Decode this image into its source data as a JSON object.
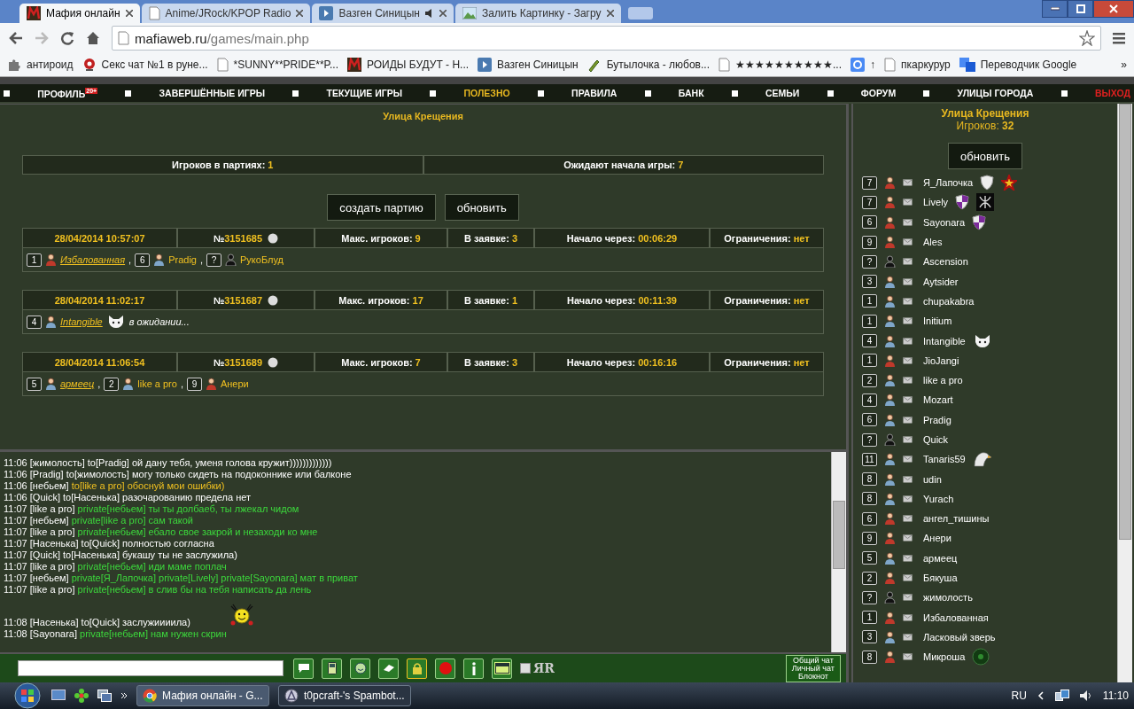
{
  "browser": {
    "tabs": [
      {
        "title": "Мафия онлайн",
        "kind": "mafia",
        "selected": true,
        "audio": false
      },
      {
        "title": "Anime/JRock/KPOP Radio",
        "kind": "page",
        "selected": false,
        "audio": false
      },
      {
        "title": "Вазген Синицын",
        "kind": "play",
        "selected": false,
        "audio": true
      },
      {
        "title": "Залить Картинку - Загру",
        "kind": "image",
        "selected": false,
        "audio": false
      }
    ],
    "address_host": "mafiaweb.ru",
    "address_path": "/games/main.php",
    "bookmarks": [
      {
        "label": "антироид",
        "kind": "puzzle"
      },
      {
        "label": "Секс чат №1 в руне...",
        "kind": "webcam"
      },
      {
        "label": "*SUNNY**PRIDE**P...",
        "kind": "page"
      },
      {
        "label": "РОИДЫ БУДУТ - Н...",
        "kind": "mafia"
      },
      {
        "label": "Вазген Синицын",
        "kind": "play"
      },
      {
        "label": "Бутылочка - любов...",
        "kind": "bottle"
      },
      {
        "label": "★★★★★★★★★★...",
        "kind": "page"
      },
      {
        "label": "↑",
        "kind": "google"
      },
      {
        "label": "пкаркурур",
        "kind": "page"
      },
      {
        "label": "Переводчик Google",
        "kind": "translate"
      }
    ],
    "bookmarks_more": "»"
  },
  "nav": [
    {
      "label": "ПРОФИЛЬ",
      "badge": "20+",
      "kind": "normal",
      "selected": false
    },
    {
      "label": "ЗАВЕРШЁННЫЕ ИГРЫ",
      "kind": "normal",
      "selected": false
    },
    {
      "label": "ТЕКУЩИЕ ИГРЫ",
      "kind": "normal",
      "selected": false
    },
    {
      "label": "ПОЛЕЗНО",
      "kind": "normal",
      "selected": true
    },
    {
      "label": "ПРАВИЛА",
      "kind": "normal",
      "selected": false
    },
    {
      "label": "БАНК",
      "kind": "normal",
      "selected": false
    },
    {
      "label": "СЕМЬИ",
      "kind": "normal",
      "selected": false
    },
    {
      "label": "ФОРУМ",
      "kind": "normal",
      "selected": false
    },
    {
      "label": "УЛИЦЫ ГОРОДА",
      "kind": "normal",
      "selected": false
    },
    {
      "label": "ВЫХОД",
      "kind": "exit",
      "selected": false
    }
  ],
  "lobby": {
    "title": "Улица Крещения",
    "stats": [
      {
        "label": "Игроков в партиях:",
        "value": "1"
      },
      {
        "label": "Ожидают начала игры:",
        "value": "7"
      }
    ],
    "buttons": [
      "создать партию",
      "обновить"
    ],
    "games": [
      {
        "date": "28/04/2014 10:57:07",
        "number_prefix": "№",
        "number": "3151685",
        "info": [
          {
            "label": "Макс. игроков:",
            "value": "9"
          },
          {
            "label": "В заявке:",
            "value": "3"
          },
          {
            "label": "Начало через:",
            "value": "00:06:29"
          },
          {
            "label": "Ограничения:",
            "value": "нет"
          }
        ],
        "players": [
          {
            "rank": "1",
            "kind": "female",
            "name": "Избалованная",
            "link": true,
            "sep": ","
          },
          {
            "rank": "6",
            "kind": "male",
            "name": "Pradig",
            "link": false,
            "sep": ","
          },
          {
            "rank": "?",
            "kind": "unknown",
            "name": "РукоБлуд",
            "link": false
          }
        ]
      },
      {
        "date": "28/04/2014 11:02:17",
        "number_prefix": "№",
        "number": "3151687",
        "info": [
          {
            "label": "Макс. игроков:",
            "value": "17"
          },
          {
            "label": "В заявке:",
            "value": "1"
          },
          {
            "label": "Начало через:",
            "value": "00:11:39"
          },
          {
            "label": "Ограничения:",
            "value": "нет"
          }
        ],
        "players": [
          {
            "rank": "4",
            "kind": "male",
            "name": "Intangible",
            "link": true,
            "badges": [
              {
                "kind": "cat"
              }
            ]
          }
        ],
        "status": "в ожидании..."
      },
      {
        "date": "28/04/2014 11:06:54",
        "number_prefix": "№",
        "number": "3151689",
        "info": [
          {
            "label": "Макс. игроков:",
            "value": "7"
          },
          {
            "label": "В заявке:",
            "value": "3"
          },
          {
            "label": "Начало через:",
            "value": "00:16:16"
          },
          {
            "label": "Ограничения:",
            "value": "нет"
          }
        ],
        "players": [
          {
            "rank": "5",
            "kind": "male",
            "name": "армеец",
            "link": true,
            "sep": ","
          },
          {
            "rank": "2",
            "kind": "male",
            "name": "like a pro",
            "link": false,
            "sep": ","
          },
          {
            "rank": "9",
            "kind": "female",
            "name": "Анери",
            "link": false
          }
        ]
      }
    ]
  },
  "chat": {
    "messages": [
      {
        "time": "11:06",
        "sender": "[жимолость]",
        "text": "to[Pradig] ой дану тебя, уменя голова кружит)))))))))))))",
        "kind": "plain"
      },
      {
        "time": "11:06",
        "sender": "[Pradig]",
        "text": "to[жимолость] могу только сидеть на подоконнике или балконе",
        "kind": "plain"
      },
      {
        "time": "11:06",
        "sender": "[небьем]",
        "text": "to[like a pro] обоснуй мои ошибки)",
        "kind": "to-me"
      },
      {
        "time": "11:06",
        "sender": "[Quick]",
        "text": "to[Насенька] разочарованию предела нет",
        "kind": "plain"
      },
      {
        "time": "11:07",
        "sender": "[like a pro]",
        "text": "private[небьем] ты ты долбаеб, ты лжекал чидом",
        "kind": "private"
      },
      {
        "time": "11:07",
        "sender": "[небьем]",
        "text": "private[like a pro] сам такой",
        "kind": "private"
      },
      {
        "time": "11:07",
        "sender": "[like a pro]",
        "text": "private[небьем] ебало свое закрой и незаходи ко мне",
        "kind": "private"
      },
      {
        "time": "11:07",
        "sender": "[Насенька]",
        "text": "to[Quick] полностью согласна",
        "kind": "plain"
      },
      {
        "time": "11:07",
        "sender": "[Quick]",
        "text": "to[Насенька] букашу ты не заслужила)",
        "kind": "plain"
      },
      {
        "time": "11:07",
        "sender": "[like a pro]",
        "text": "private[небьем] иди маме поплач",
        "kind": "private"
      },
      {
        "time": "11:07",
        "sender": "[небьем]",
        "text": "private[Я_Лапочка] private[Lively] private[Sayonara] мат в приват",
        "kind": "private"
      },
      {
        "time": "11:07",
        "sender": "[like a pro]",
        "text": "private[небьем] в слив бы на тебя написать да лень",
        "kind": "private"
      },
      {
        "time": "11:08",
        "sender": "[Насенька]",
        "text": "to[Quick] заслужиииила)",
        "kind": "plain",
        "smiley": true
      },
      {
        "time": "11:08",
        "sender": "[Sayonara]",
        "text": "private[небьем] нам нужен скрин",
        "kind": "private"
      }
    ],
    "tools": [
      {
        "kind": "speech",
        "selected": false
      },
      {
        "kind": "phone",
        "selected": false
      },
      {
        "kind": "smiley",
        "selected": false
      },
      {
        "kind": "eraser",
        "selected": false
      },
      {
        "kind": "lock",
        "selected": true
      },
      {
        "kind": "record",
        "selected": false
      },
      {
        "kind": "info",
        "selected": false
      },
      {
        "kind": "log",
        "selected": false
      }
    ],
    "translit": {
      "label": "ЯR",
      "checked": false
    },
    "channels": [
      "Общий чат",
      "Личный чат",
      "Блокнот"
    ]
  },
  "street": {
    "title": "Улица Крещения",
    "count_label": "Игроков:",
    "count": "32",
    "button": "обновить",
    "players": [
      {
        "rank": "7",
        "kind": "female",
        "name": "Я_Лапочка",
        "badges": [
          {
            "kind": "shield-white"
          },
          {
            "kind": "star"
          }
        ]
      },
      {
        "rank": "7",
        "kind": "female",
        "name": "Lively",
        "badges": [
          {
            "kind": "shield-purple"
          },
          {
            "kind": "knot"
          }
        ]
      },
      {
        "rank": "6",
        "kind": "female",
        "name": "Sayonara",
        "badges": [
          {
            "kind": "shield-purple"
          }
        ]
      },
      {
        "rank": "9",
        "kind": "female",
        "name": "Ales"
      },
      {
        "rank": "?",
        "kind": "unknown",
        "name": "Ascension"
      },
      {
        "rank": "3",
        "kind": "male",
        "name": "Aytsider"
      },
      {
        "rank": "1",
        "kind": "male",
        "name": "chupakabra"
      },
      {
        "rank": "1",
        "kind": "male",
        "name": "Initium"
      },
      {
        "rank": "4",
        "kind": "male",
        "name": "Intangible",
        "badges": [
          {
            "kind": "cat"
          }
        ]
      },
      {
        "rank": "1",
        "kind": "female",
        "name": "JioJangi"
      },
      {
        "rank": "2",
        "kind": "male",
        "name": "like a pro"
      },
      {
        "rank": "4",
        "kind": "male",
        "name": "Mozart"
      },
      {
        "rank": "6",
        "kind": "male",
        "name": "Pradig"
      },
      {
        "rank": "?",
        "kind": "unknown",
        "name": "Quick"
      },
      {
        "rank": "11",
        "kind": "male",
        "name": "Tanaris59",
        "badges": [
          {
            "kind": "eagle"
          }
        ]
      },
      {
        "rank": "8",
        "kind": "male",
        "name": "udin"
      },
      {
        "rank": "8",
        "kind": "male",
        "name": "Yurach"
      },
      {
        "rank": "6",
        "kind": "female",
        "name": "ангел_тишины"
      },
      {
        "rank": "9",
        "kind": "female",
        "name": "Анери"
      },
      {
        "rank": "5",
        "kind": "male",
        "name": "армеец"
      },
      {
        "rank": "2",
        "kind": "female",
        "name": "Бякуша"
      },
      {
        "rank": "?",
        "kind": "unknown",
        "name": "жимолость"
      },
      {
        "rank": "1",
        "kind": "female",
        "name": "Избалованная"
      },
      {
        "rank": "3",
        "kind": "male",
        "name": "Ласковый зверь"
      },
      {
        "rank": "8",
        "kind": "female",
        "name": "Микроша",
        "badges": [
          {
            "kind": "orb"
          }
        ]
      }
    ]
  },
  "taskbar": {
    "tasks": [
      {
        "title": "Мафия онлайн - G...",
        "kind": "chrome",
        "selected": true
      },
      {
        "title": "t0pcraft-'s Spambot...",
        "kind": "bot",
        "selected": false
      }
    ],
    "language": "RU",
    "time": "11:10"
  }
}
